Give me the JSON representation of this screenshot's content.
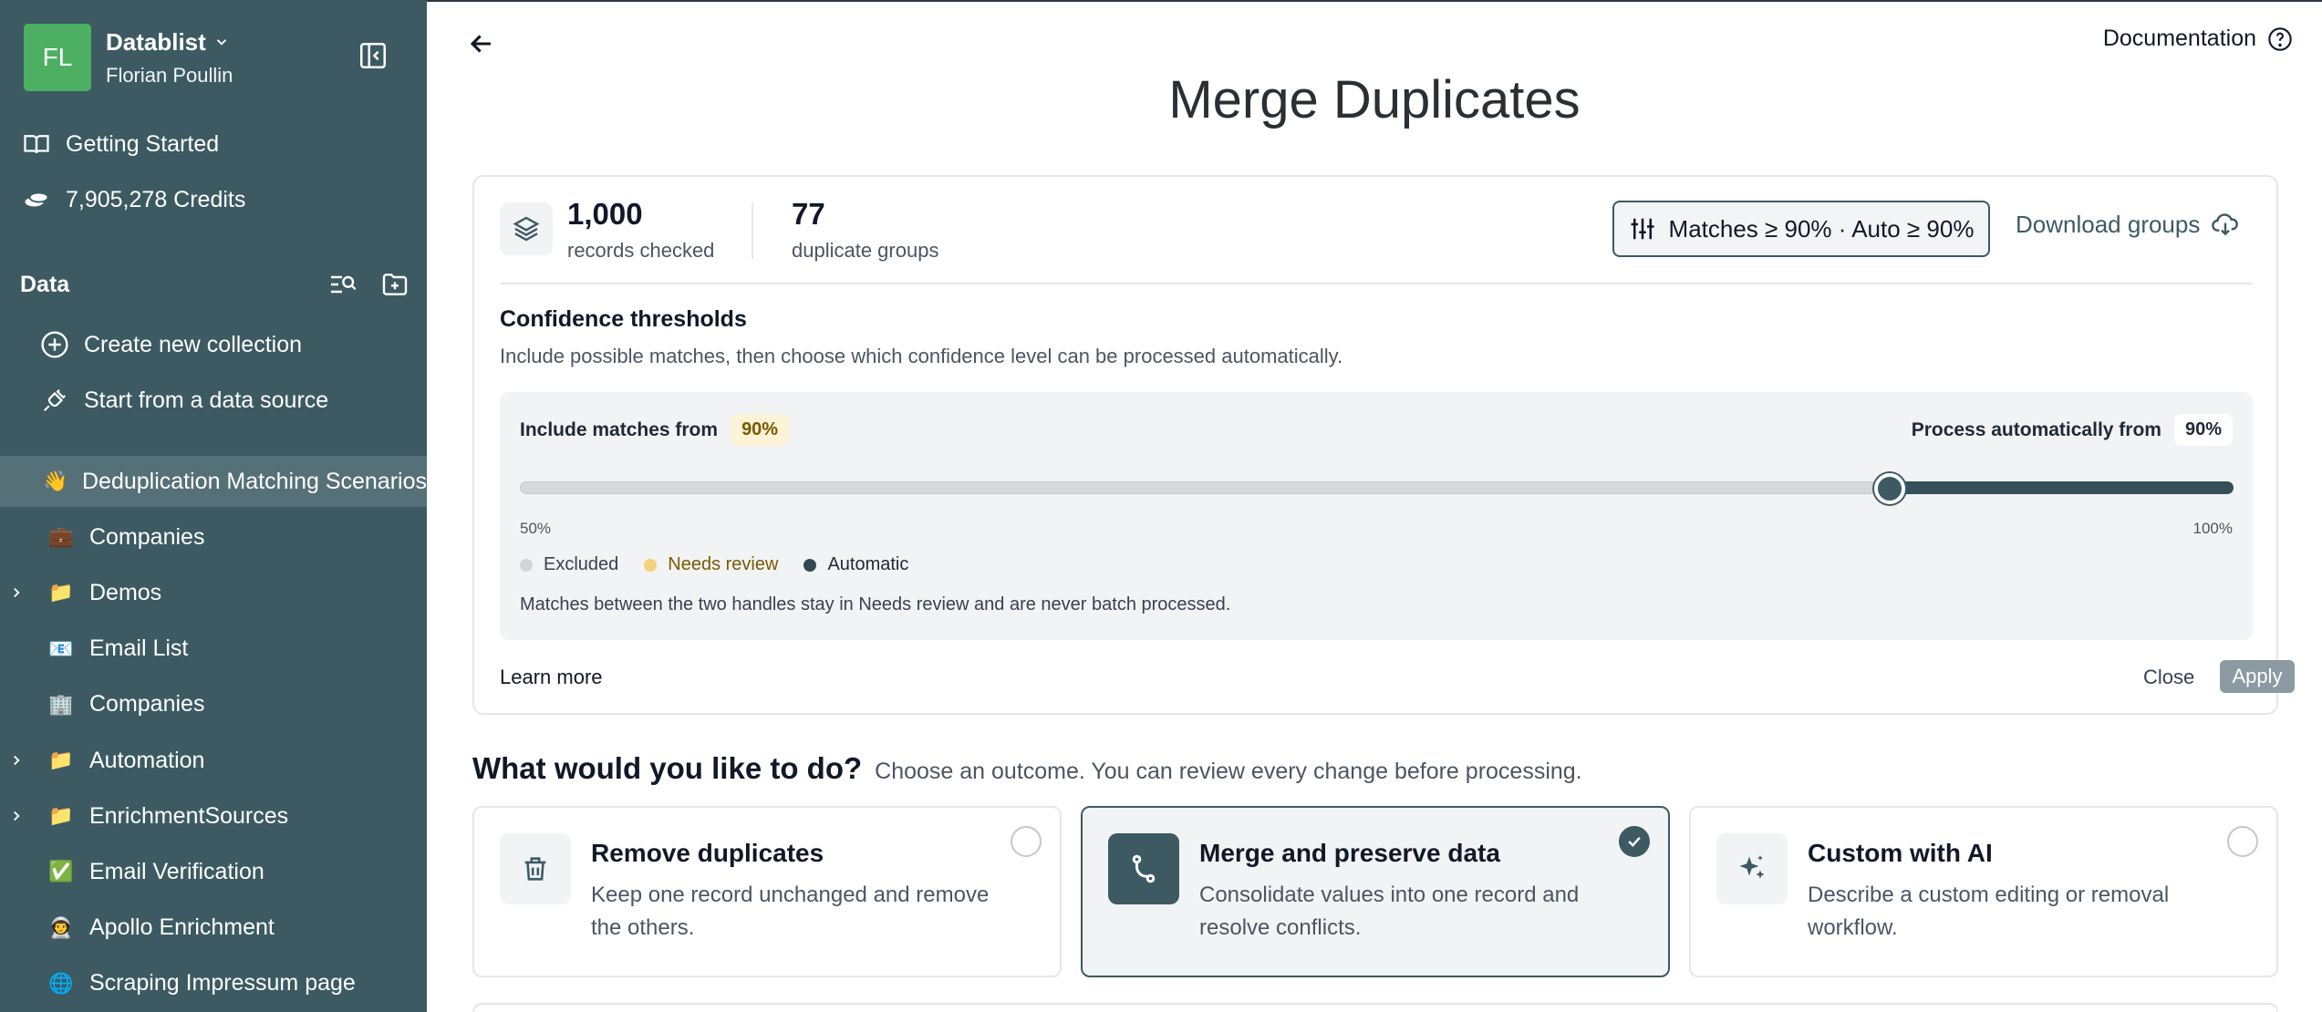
{
  "workspace": {
    "initials": "FL",
    "name": "Datablist",
    "user": "Florian Poullin"
  },
  "nav": {
    "getting_started": "Getting Started",
    "credits": "7,905,278 Credits",
    "data_title": "Data",
    "create_collection": "Create new collection",
    "start_source": "Start from a data source"
  },
  "collections": [
    {
      "emoji": "👋",
      "label": "Deduplication Matching Scenarios",
      "expandable": false,
      "active": true
    },
    {
      "emoji": "💼",
      "label": "Companies",
      "expandable": false,
      "active": false
    },
    {
      "emoji": "📁",
      "label": "Demos",
      "expandable": true,
      "active": false
    },
    {
      "emoji": "📧",
      "label": "Email List",
      "expandable": false,
      "active": false
    },
    {
      "emoji": "🏢",
      "label": "Companies",
      "expandable": false,
      "active": false
    },
    {
      "emoji": "📁",
      "label": "Automation",
      "expandable": true,
      "active": false
    },
    {
      "emoji": "📁",
      "label": "EnrichmentSources",
      "expandable": true,
      "active": false
    },
    {
      "emoji": "✅",
      "label": "Email Verification",
      "expandable": false,
      "active": false
    },
    {
      "emoji": "👨‍🚀",
      "label": "Apollo Enrichment",
      "expandable": false,
      "active": false
    },
    {
      "emoji": "🌐",
      "label": "Scraping Impressum page",
      "expandable": false,
      "active": false
    }
  ],
  "header": {
    "documentation": "Documentation",
    "title": "Merge Duplicates"
  },
  "stats": {
    "records_value": "1,000",
    "records_label": "records checked",
    "groups_value": "77",
    "groups_label": "duplicate groups",
    "threshold_button": "Matches ≥ 90% · Auto ≥ 90%",
    "download": "Download groups"
  },
  "thresholds": {
    "title": "Confidence thresholds",
    "description": "Include possible matches, then choose which confidence level can be processed automatically.",
    "include_label": "Include matches from",
    "include_value": "90%",
    "auto_label": "Process automatically from",
    "auto_value": "90%",
    "include_percent": 90,
    "auto_percent": 90,
    "scale_min_value": 50,
    "scale_max_value": 100,
    "scale_min": "50%",
    "scale_max": "100%",
    "legend": [
      {
        "label": "Excluded",
        "color": "#d1d5db",
        "text_color": "#374151"
      },
      {
        "label": "Needs review",
        "color": "#f2d27a",
        "text_color": "#7a5a00"
      },
      {
        "label": "Automatic",
        "color": "#2f4a52",
        "text_color": "#1f2937"
      }
    ],
    "note": "Matches between the two handles stay in Needs review and are never batch processed.",
    "learn_more": "Learn more",
    "close": "Close",
    "apply": "Apply"
  },
  "outcome": {
    "title": "What would you like to do?",
    "subtitle": "Choose an outcome. You can review every change before processing.",
    "cards": [
      {
        "title": "Remove duplicates",
        "description": "Keep one record unchanged and remove the others.",
        "icon": "trash-icon",
        "selected": false
      },
      {
        "title": "Merge and preserve data",
        "description": "Consolidate values into one record and resolve conflicts.",
        "icon": "merge-icon",
        "selected": true
      },
      {
        "title": "Custom with AI",
        "description": "Describe a custom editing or removal workflow.",
        "icon": "sparkles-icon",
        "selected": false
      }
    ]
  }
}
